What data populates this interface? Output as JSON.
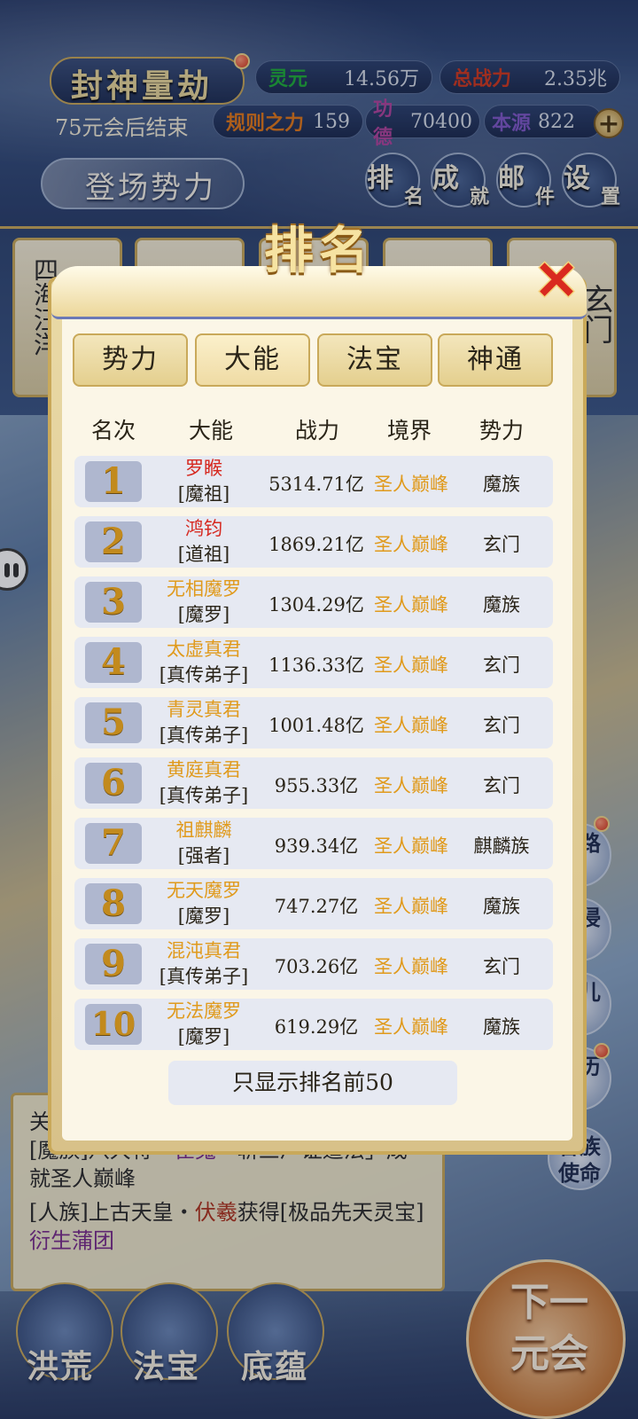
{
  "hud": {
    "title": "封神量劫",
    "end_note": "75元会后结束",
    "stats": [
      {
        "label": "灵元",
        "value": "14.56万",
        "label_color": "#1fae3a"
      },
      {
        "label": "总战力",
        "value": "2.35兆",
        "label_color": "#d0391f"
      },
      {
        "label": "规则之力",
        "value": "159",
        "label_color": "#e2781a"
      },
      {
        "label": "功德",
        "value": "70400",
        "label_color": "#b0449e"
      },
      {
        "label": "本源",
        "value": "822",
        "label_color": "#7f58c9"
      }
    ],
    "plus_icon": "plus-icon",
    "faction_banner": "登场势力",
    "menu": [
      {
        "big": "排",
        "small": "名"
      },
      {
        "big": "成",
        "small": "就"
      },
      {
        "big": "邮",
        "small": "件"
      },
      {
        "big": "设",
        "small": "置"
      }
    ]
  },
  "strip": {
    "cards": [
      "四海汪洋",
      "玄门"
    ]
  },
  "side_buttons": [
    "道路",
    "域侵",
    "道儿",
    "身历",
    "各族使命"
  ],
  "news": {
    "line0": "关",
    "item1": {
      "prefix": "[魔族]八大将・",
      "name": "崔嵬",
      "suffix": "「斩三尸证道法」成就圣人巅峰"
    },
    "item2": {
      "prefix": "[人族]上古天皇・",
      "name": "伏羲",
      "middle": "获得[极品先天灵宝]",
      "item": "衍生蒲团"
    }
  },
  "bottom_nav": [
    "洪荒",
    "法宝",
    "底蕴"
  ],
  "next_button": "下一元会",
  "modal": {
    "title": "排名",
    "close_icon": "close-icon",
    "tabs": [
      "势力",
      "大能",
      "法宝",
      "神通"
    ],
    "active_tab": "大能",
    "columns": [
      "名次",
      "大能",
      "战力",
      "境界",
      "势力"
    ],
    "rows": [
      {
        "rank": "1",
        "name": "罗睺",
        "title": "[魔祖]",
        "power": "5314.71亿",
        "realm": "圣人巅峰",
        "faction": "魔族",
        "name_color": "#d6281f"
      },
      {
        "rank": "2",
        "name": "鸿钧",
        "title": "[道祖]",
        "power": "1869.21亿",
        "realm": "圣人巅峰",
        "faction": "玄门",
        "name_color": "#d6281f"
      },
      {
        "rank": "3",
        "name": "无相魔罗",
        "title": "[魔罗]",
        "power": "1304.29亿",
        "realm": "圣人巅峰",
        "faction": "魔族",
        "name_color": "#e09a1c"
      },
      {
        "rank": "4",
        "name": "太虚真君",
        "title": "[真传弟子]",
        "power": "1136.33亿",
        "realm": "圣人巅峰",
        "faction": "玄门",
        "name_color": "#e09a1c"
      },
      {
        "rank": "5",
        "name": "青灵真君",
        "title": "[真传弟子]",
        "power": "1001.48亿",
        "realm": "圣人巅峰",
        "faction": "玄门",
        "name_color": "#e09a1c"
      },
      {
        "rank": "6",
        "name": "黄庭真君",
        "title": "[真传弟子]",
        "power": "955.33亿",
        "realm": "圣人巅峰",
        "faction": "玄门",
        "name_color": "#e09a1c"
      },
      {
        "rank": "7",
        "name": "祖麒麟",
        "title": "[强者]",
        "power": "939.34亿",
        "realm": "圣人巅峰",
        "faction": "麒麟族",
        "name_color": "#e09a1c"
      },
      {
        "rank": "8",
        "name": "无天魔罗",
        "title": "[魔罗]",
        "power": "747.27亿",
        "realm": "圣人巅峰",
        "faction": "魔族",
        "name_color": "#e09a1c"
      },
      {
        "rank": "9",
        "name": "混沌真君",
        "title": "[真传弟子]",
        "power": "703.26亿",
        "realm": "圣人巅峰",
        "faction": "玄门",
        "name_color": "#e09a1c"
      },
      {
        "rank": "10",
        "name": "无法魔罗",
        "title": "[魔罗]",
        "power": "619.29亿",
        "realm": "圣人巅峰",
        "faction": "魔族",
        "name_color": "#e09a1c"
      }
    ],
    "footer": "只显示排名前50"
  }
}
